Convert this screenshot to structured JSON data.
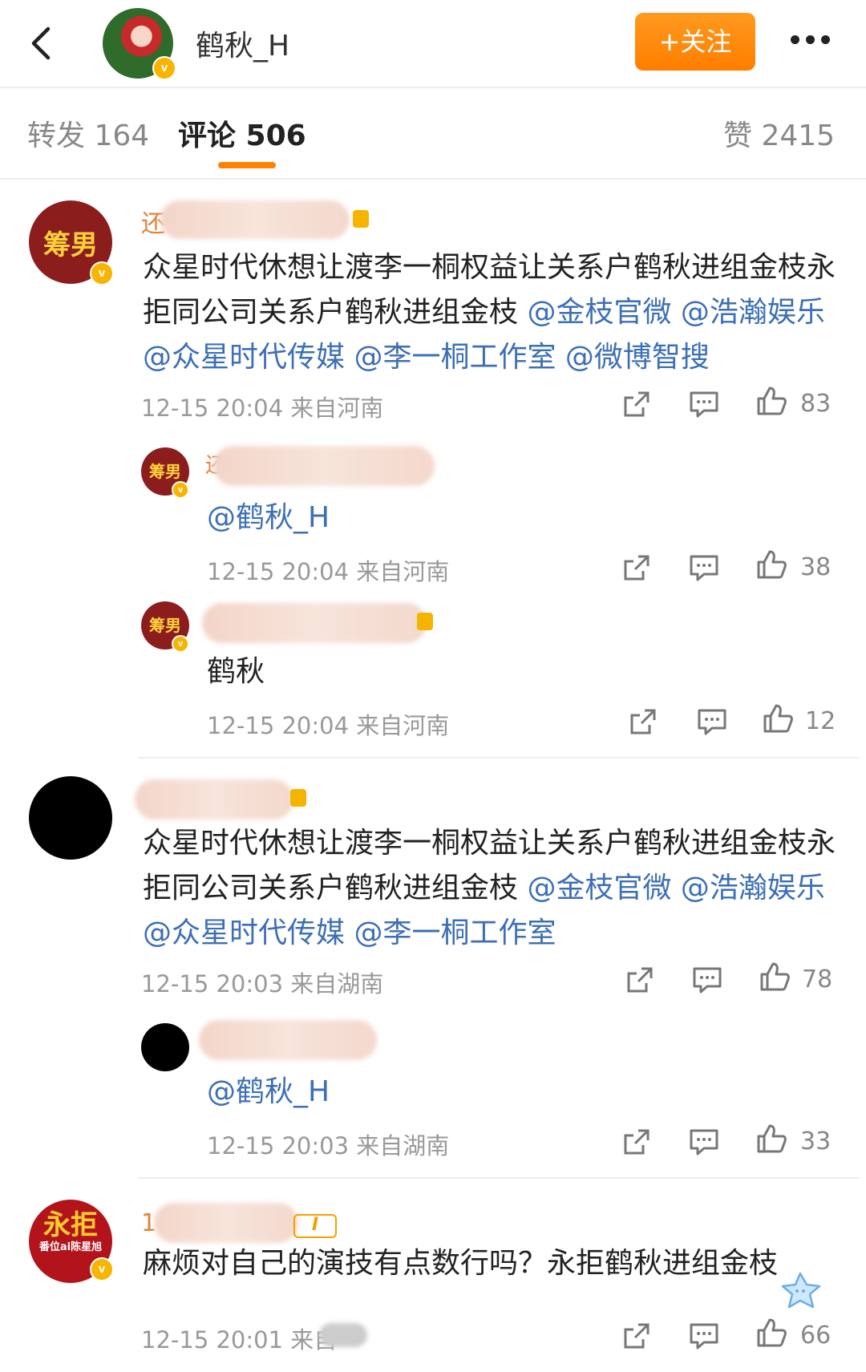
{
  "header": {
    "title": "鹤秋_H",
    "follow_label": "+关注",
    "verified_mark": "v"
  },
  "tabs": [
    {
      "label": "转发 164"
    },
    {
      "label": "评论 506"
    },
    {
      "label": "赞 2415"
    }
  ],
  "colors": {
    "accent_orange": "#ff8200",
    "mention_blue": "#3d6fb6",
    "meta_gray": "#999999"
  },
  "icons": [
    "back-arrow-icon",
    "more-dots-icon",
    "share-icon",
    "comment-icon",
    "like-icon",
    "verified-icon"
  ],
  "comments": [
    {
      "avatar_text": "筹男",
      "name_fragment": "还",
      "body": "众星时代休想让渡李一桐权益让关系户鹤秋进组金枝永拒同公司关系户鹤秋进组金枝 ",
      "mentions": "@金枝官微 @浩瀚娱乐 @众星时代传媒 @李一桐工作室 @微博智搜",
      "meta": "12-15 20:04  来自河南",
      "likes": "83",
      "replies": [
        {
          "avatar_text": "筹男",
          "name_fragment": "还",
          "body": "@鹤秋_H",
          "meta": "12-15 20:04  来自河南",
          "likes": "38"
        },
        {
          "avatar_text": "筹男",
          "name_fragment": "",
          "body": "鹤秋",
          "meta": "12-15 20:04  来自河南",
          "likes": "12"
        }
      ]
    },
    {
      "avatar_text": "",
      "name_fragment": "",
      "body": "众星时代休想让渡李一桐权益让关系户鹤秋进组金枝永拒同公司关系户鹤秋进组金枝 ",
      "mentions": "@金枝官微 @浩瀚娱乐 @众星时代传媒 @李一桐工作室",
      "meta": "12-15 20:03  来自湖南",
      "likes": "78",
      "replies": [
        {
          "avatar_text": "",
          "name_fragment": "",
          "body": "@鹤秋_H",
          "meta": "12-15 20:03  来自湖南",
          "likes": "33"
        }
      ]
    },
    {
      "avatar_text": "永拒",
      "avatar_subtext": "番位ai陈星旭",
      "name_fragment": "1",
      "badge": "I",
      "body": "麻烦对自己的演技有点数行吗？永拒鹤秋进组金枝",
      "meta": "12-15 20:01  来自",
      "likes": "66"
    }
  ]
}
